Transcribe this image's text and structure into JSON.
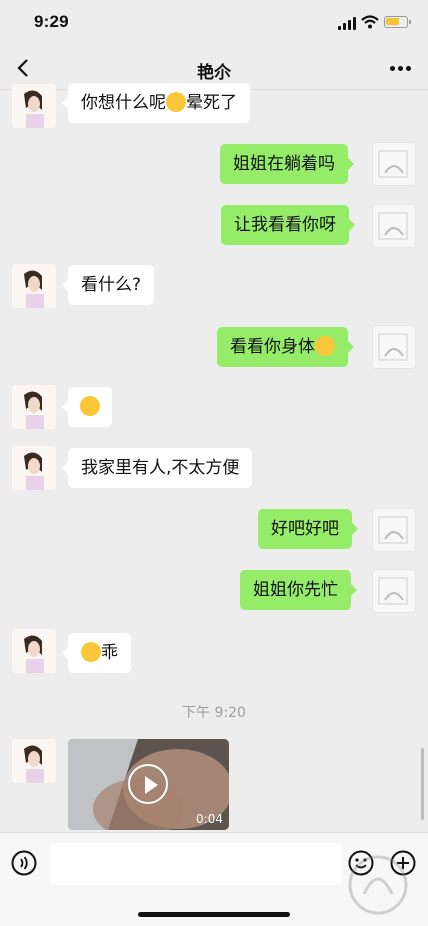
{
  "status_bar": {
    "time": "9:29"
  },
  "nav": {
    "title": "艳尒"
  },
  "messages": [
    {
      "side": "left",
      "text": "你想什么呢",
      "suffix": "晕死了"
    },
    {
      "side": "right",
      "text": "姐姐在躺着吗"
    },
    {
      "side": "right",
      "text": "让我看看你呀"
    },
    {
      "side": "left",
      "text": "看什么?"
    },
    {
      "side": "right",
      "text": "看看你身体"
    },
    {
      "side": "left",
      "text": ""
    },
    {
      "side": "left",
      "text": "我家里有人,不太方便"
    },
    {
      "side": "right",
      "text": "好吧好吧"
    },
    {
      "side": "right",
      "text": "姐姐你先忙"
    },
    {
      "side": "left",
      "text": "乖"
    }
  ],
  "timestamp": "下午 9:20",
  "video": {
    "duration": "0:04"
  },
  "input": {
    "placeholder": ""
  },
  "colors": {
    "right_bubble": "#95ec69",
    "left_bubble": "#ffffff",
    "background": "#ededed"
  }
}
